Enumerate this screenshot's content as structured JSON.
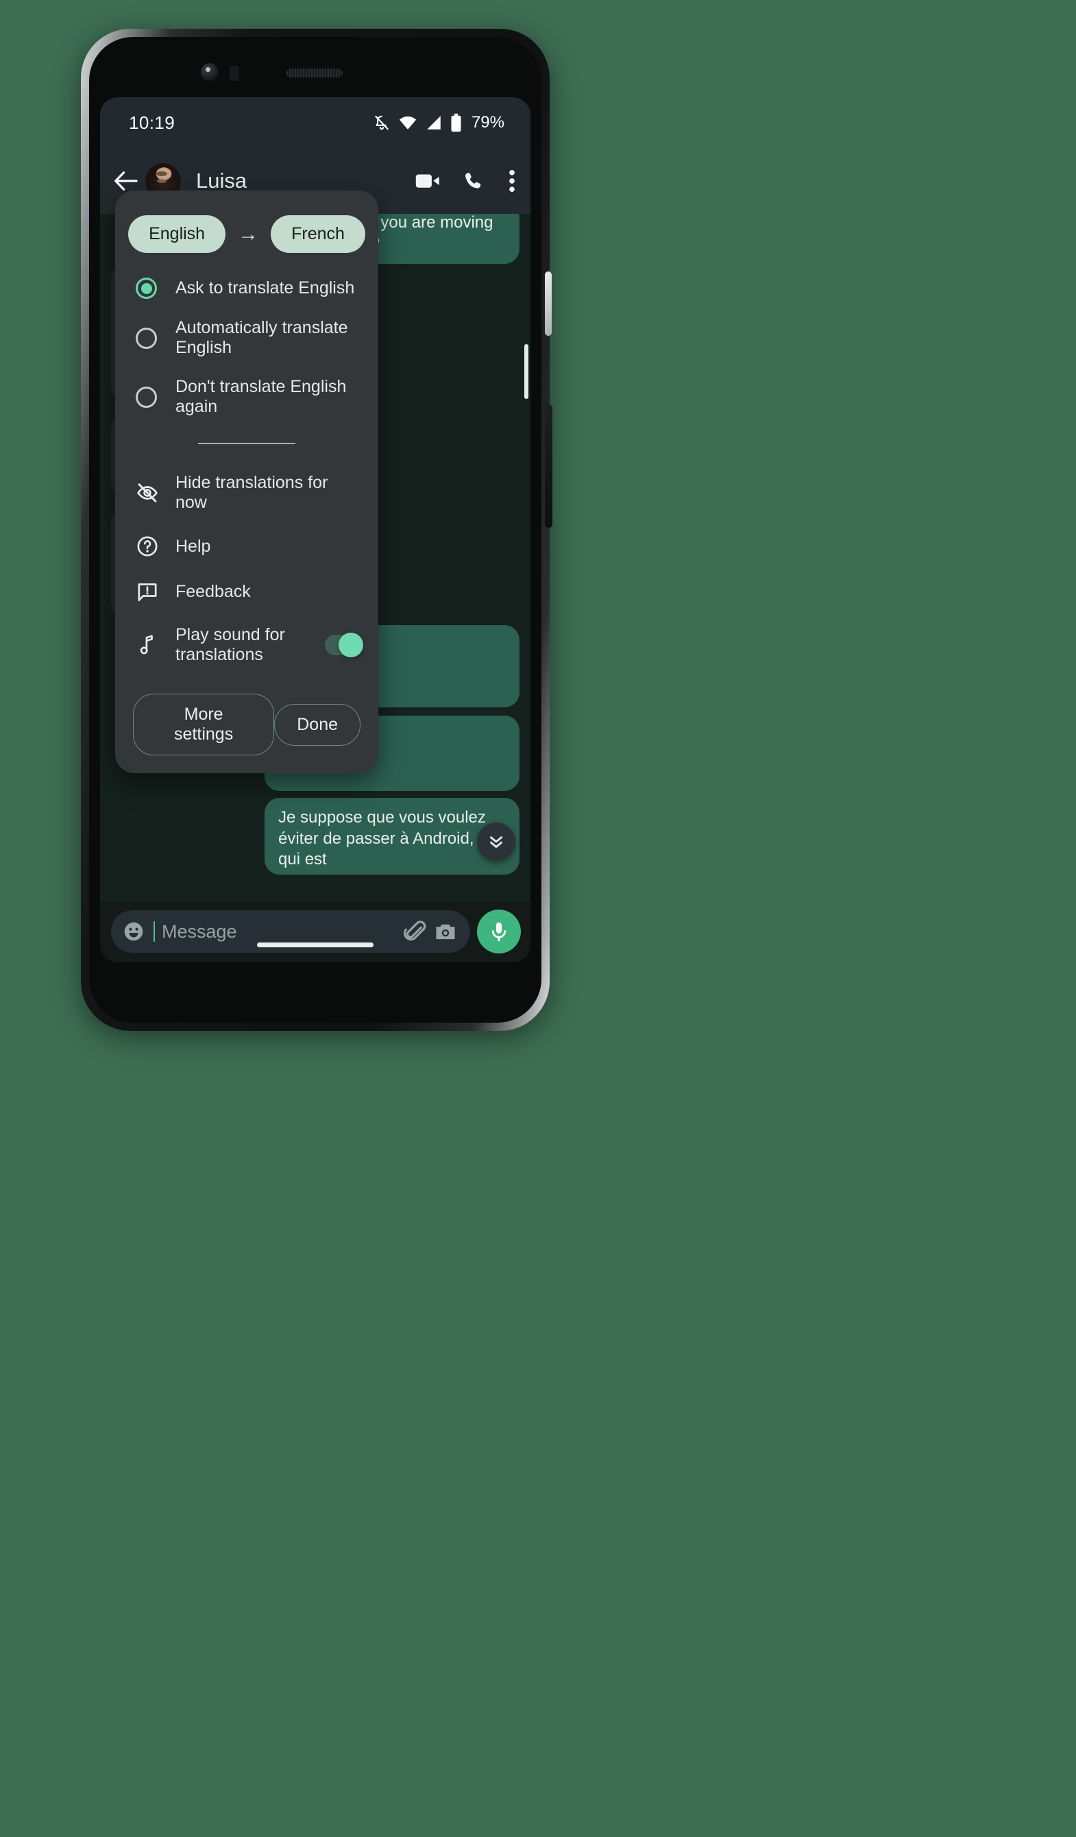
{
  "status_bar": {
    "time": "10:19",
    "battery_percent": "79%",
    "icons": [
      "notifications-off-icon",
      "wifi-icon",
      "cell-signal-icon",
      "battery-icon"
    ]
  },
  "app_bar": {
    "back_label": "back-arrow",
    "contact_name": "Luisa",
    "actions": [
      "video-call-icon",
      "voice-call-icon",
      "overflow-menu-icon"
    ]
  },
  "chat": {
    "bubbles": [
      {
        "side": "out",
        "text": "I see. I take it you are moving to an iPhone?"
      },
      {
        "side": "in",
        "text": ""
      },
      {
        "side": "out",
        "text": "Je suppose que vous voulez éviter de passer à Android, ce qui est"
      }
    ],
    "scroll_to_bottom_icon": "double-chevron-down-icon"
  },
  "dialog": {
    "source_language": "English",
    "target_language": "French",
    "arrow": "→",
    "options": [
      {
        "label": "Ask to translate English",
        "selected": true
      },
      {
        "label": "Automatically translate English",
        "selected": false
      },
      {
        "label": "Don't translate English again",
        "selected": false
      }
    ],
    "menu_items": [
      {
        "label": "Hide translations for now",
        "icon": "eye-off-icon",
        "has_toggle": false
      },
      {
        "label": "Help",
        "icon": "help-circle-icon",
        "has_toggle": false
      },
      {
        "label": "Feedback",
        "icon": "feedback-bubble-icon",
        "has_toggle": false
      },
      {
        "label": "Play sound for translations",
        "icon": "music-note-icon",
        "has_toggle": true,
        "toggle_on": true
      }
    ],
    "more_settings_label": "More settings",
    "done_label": "Done"
  },
  "composer": {
    "placeholder": "Message",
    "emoji_icon": "emoji-smiley-icon",
    "attach_icon": "paperclip-icon",
    "camera_icon": "camera-icon",
    "mic_icon": "microphone-icon"
  },
  "colors": {
    "accent_mint": "#67d7ac",
    "chip_bg": "#c3dccd",
    "bubble_out": "#2c6152",
    "dialog_bg": "#333739",
    "appbar_bg": "#232a2f",
    "chat_bg": "#14211c",
    "mic_fab": "#3fb57f",
    "page_bg": "#3d6d52"
  }
}
